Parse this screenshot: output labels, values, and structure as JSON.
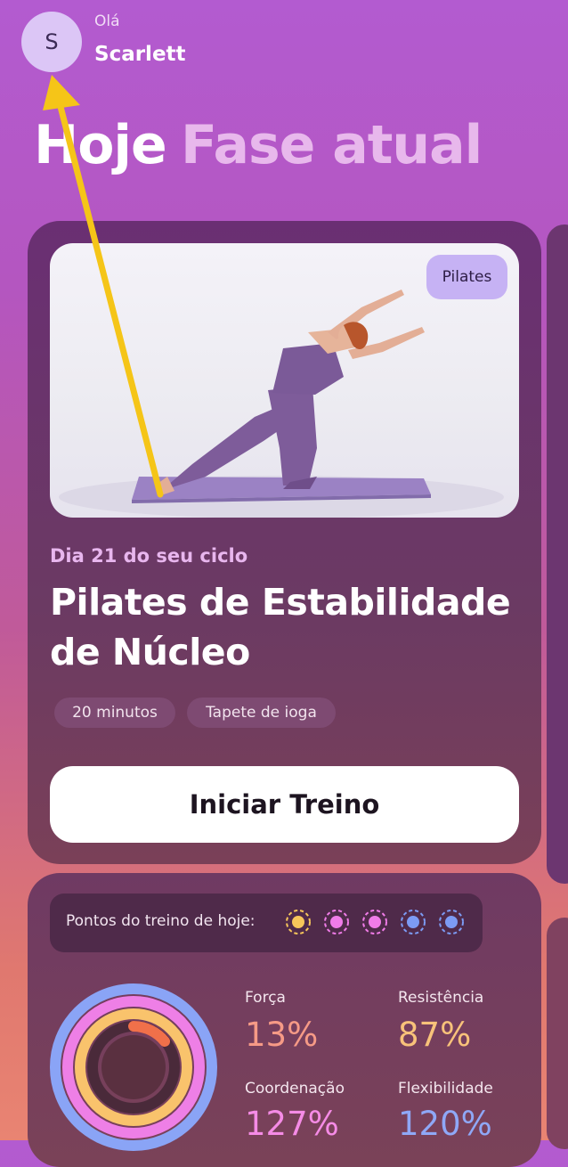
{
  "header": {
    "avatar_initial": "S",
    "greeting": "Olá",
    "username": "Scarlett"
  },
  "tabs": [
    {
      "label": "Hoje",
      "active": true
    },
    {
      "label": "Fase atual",
      "active": false
    }
  ],
  "workout": {
    "category_badge": "Pilates",
    "day_line": "Dia 21 do seu ciclo",
    "title": "Pilates de Estabilidade de Núcleo",
    "chips": [
      "20 minutos",
      "Tapete de ioga"
    ],
    "start_button": "Iniciar Treino"
  },
  "points": {
    "label": "Pontos do treino de hoje:",
    "dots": [
      {
        "icon": "yellow-dot-icon",
        "color": "#f7c65a"
      },
      {
        "icon": "pink-dot-icon",
        "color": "#f07ce8"
      },
      {
        "icon": "pink-dot-icon",
        "color": "#f07ce8"
      },
      {
        "icon": "blue-dot-icon",
        "color": "#7c9bf4"
      },
      {
        "icon": "blue-dot-icon",
        "color": "#7c9bf4"
      }
    ]
  },
  "stats": [
    {
      "label": "Força",
      "value": "13%",
      "color": "#f69a86"
    },
    {
      "label": "Resistência",
      "value": "87%",
      "color": "#f8c27a"
    },
    {
      "label": "Coordenação",
      "value": "127%",
      "color": "#f58be6"
    },
    {
      "label": "Flexibilidade",
      "value": "120%",
      "color": "#8fa8f7"
    }
  ],
  "colors": {
    "accent_arrow": "#f5c518",
    "button_bg": "#ffffff",
    "badge_bg": "#c6b2f4"
  }
}
